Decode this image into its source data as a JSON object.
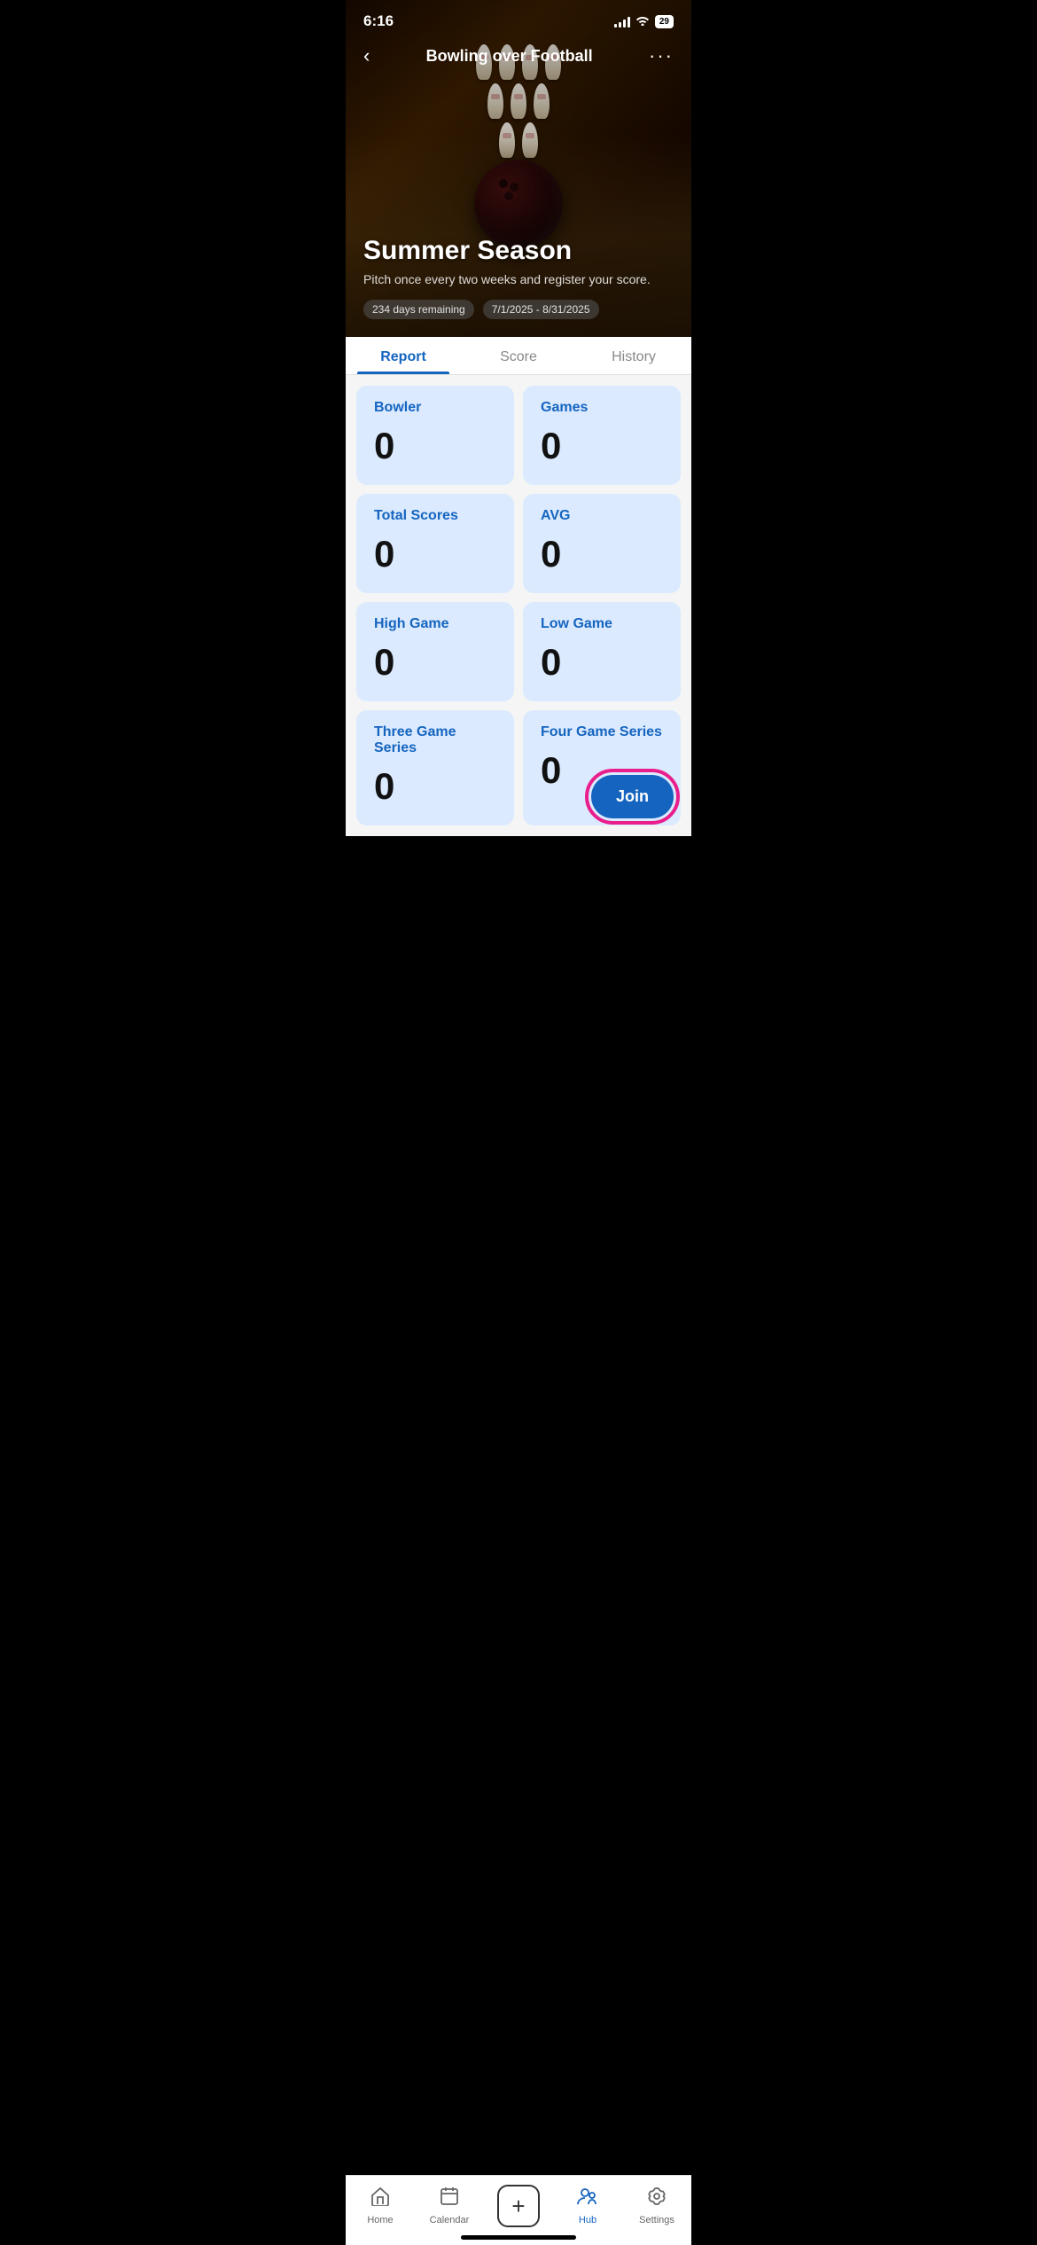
{
  "statusBar": {
    "time": "6:16",
    "battery": "29"
  },
  "hero": {
    "title": "Bowling over Football",
    "backLabel": "‹",
    "moreLabel": "···",
    "seasonTitle": "Summer Season",
    "seasonDesc": "Pitch once every two weeks and register your score.",
    "daysRemaining": "234 days remaining",
    "dateRange": "7/1/2025 - 8/31/2025"
  },
  "tabs": [
    {
      "id": "report",
      "label": "Report",
      "active": true
    },
    {
      "id": "score",
      "label": "Score",
      "active": false
    },
    {
      "id": "history",
      "label": "History",
      "active": false
    }
  ],
  "stats": [
    {
      "label": "Bowler",
      "value": "0"
    },
    {
      "label": "Games",
      "value": "0"
    },
    {
      "label": "Total Scores",
      "value": "0"
    },
    {
      "label": "AVG",
      "value": "0"
    },
    {
      "label": "High Game",
      "value": "0"
    },
    {
      "label": "Low Game",
      "value": "0"
    },
    {
      "label": "Three Game Series",
      "value": "0"
    },
    {
      "label": "Four Game Series",
      "value": "0"
    }
  ],
  "joinButton": {
    "label": "Join"
  },
  "bottomNav": [
    {
      "id": "home",
      "label": "Home",
      "icon": "⌂",
      "active": false
    },
    {
      "id": "calendar",
      "label": "Calendar",
      "icon": "📅",
      "active": false
    },
    {
      "id": "add",
      "label": "",
      "icon": "+",
      "active": false
    },
    {
      "id": "hub",
      "label": "Hub",
      "icon": "👥",
      "active": true
    },
    {
      "id": "settings",
      "label": "Settings",
      "icon": "⚙",
      "active": false
    }
  ]
}
